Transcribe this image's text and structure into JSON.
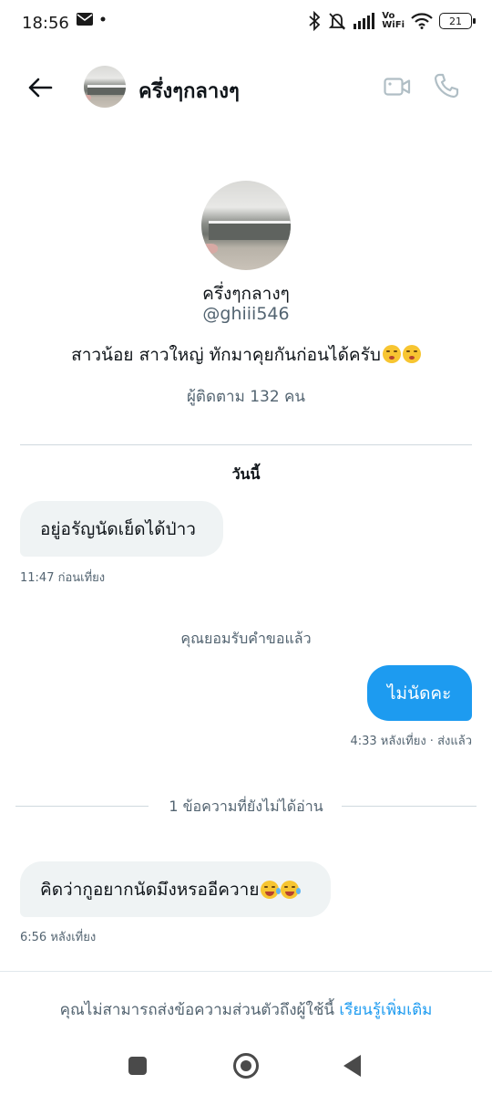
{
  "status_bar": {
    "time": "18:56",
    "vowifi_top": "Vo",
    "vowifi_bottom": "WiFi",
    "battery": "21",
    "icons": [
      "mail-icon",
      "dot-icon",
      "bluetooth-icon",
      "mute-icon",
      "signal-icon",
      "vowifi-icon",
      "wifi-icon",
      "battery-icon"
    ]
  },
  "header": {
    "title": "ครึ่งๆกลางๆ",
    "icons": [
      "back-arrow-icon",
      "video-camera-icon",
      "phone-icon"
    ]
  },
  "profile": {
    "name": "ครึ่งๆกลางๆ",
    "handle": "@ghiii546",
    "bio": "สาวน้อย สาวใหญ่  ทักมาคุยกันก่อนได้ครับ",
    "bio_emojis": [
      "kissing-face-icon",
      "kissing-face-icon"
    ],
    "followers": "ผู้ติดตาม 132 คน"
  },
  "conversation": {
    "date_label": "วันนี้",
    "msg1": {
      "text": "อยู่อรัญนัดเย็ดได้ป่าว",
      "meta": "11:47 ก่อนเที่ยง"
    },
    "system_text": "คุณยอมรับคำขอแล้ว",
    "msg2": {
      "text": "ไม่นัดคะ",
      "meta": "4:33 หลังเที่ยง · ส่งแล้ว"
    },
    "unread_label": "1 ข้อความที่ยังไม่ได้อ่าน",
    "msg3": {
      "text": "คิดว่ากูอยากนัดมึงหรออีควาย",
      "emojis": [
        "rofl-icon",
        "rofl-icon"
      ],
      "meta": "6:56 หลังเที่ยง"
    }
  },
  "footer": {
    "cannot_dm": "คุณไม่สามารถส่งข้อความส่วนตัวถึงผู้ใช้นี้",
    "learn_more": "เรียนรู้เพิ่มเติม"
  },
  "colors": {
    "accent": "#1d9bf0",
    "incoming_bubble": "#eff3f4",
    "secondary_text": "#536471"
  }
}
